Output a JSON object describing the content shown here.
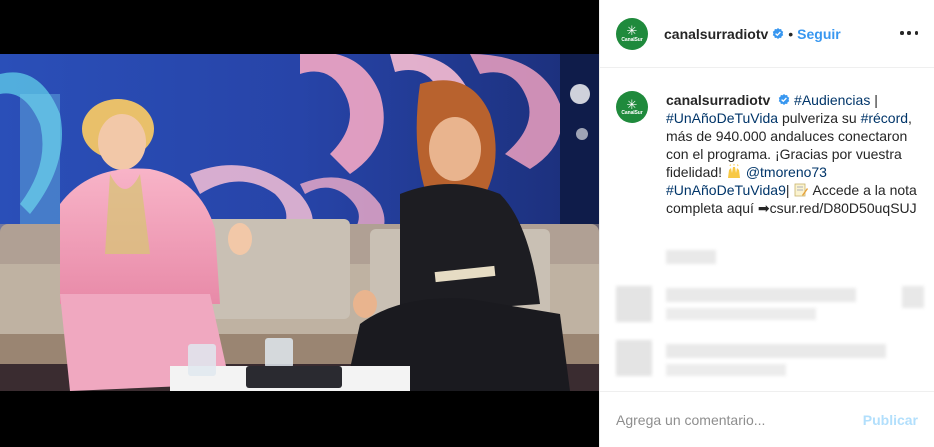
{
  "account": {
    "username": "canalsurradiotv",
    "avatar_text": "CanalSur",
    "verified": true,
    "separator": "•",
    "follow_label": "Seguir"
  },
  "caption": {
    "username": "canalsurradiotv",
    "tag_audiencias": "#Audiencias",
    "pipe": " |",
    "tag_show": "#UnAñoDeTuVida",
    "text_1": " pulveriza su ",
    "tag_record": "#récord",
    "text_2": ", más de 940.000 andaluces conectaron con el programa. ¡Gracias por vuestra fidelidad! ",
    "mention": "@tmoreno73",
    "tag_show9": " #UnAñoDeTuVida9",
    "text_3": "| ",
    "text_4": " Accede a la nota completa aquí ➡csur.red/D80D50uqSUJ",
    "emoji_hands": "raising-hands-emoji",
    "emoji_memo": "memo-emoji"
  },
  "comment": {
    "placeholder": "Agrega un comentario...",
    "publish_label": "Publicar"
  },
  "colors": {
    "link": "#003569",
    "accent": "#3897f0",
    "publish_disabled": "#b2dffc",
    "brand_green": "#1f8a3c"
  }
}
